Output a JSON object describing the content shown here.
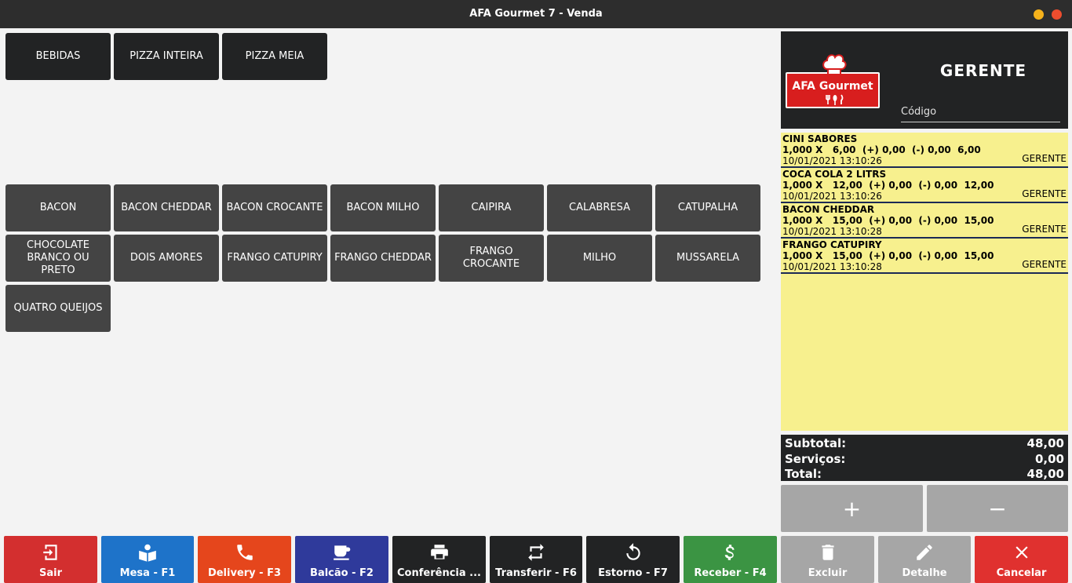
{
  "window": {
    "title": "AFA Gourmet 7 - Venda"
  },
  "categories": [
    "BEBIDAS",
    "PIZZA INTEIRA",
    "PIZZA MEIA"
  ],
  "products": [
    "BACON",
    "BACON CHEDDAR",
    "BACON CROCANTE",
    "BACON MILHO",
    "CAIPIRA",
    "CALABRESA",
    "CATUPALHA",
    "CHOCOLATE BRANCO OU PRETO",
    "DOIS AMORES",
    "FRANGO CATUPIRY",
    "FRANGO CHEDDAR",
    "FRANGO CROCANTE",
    "MILHO",
    "MUSSARELA",
    "QUATRO QUEIJOS"
  ],
  "header": {
    "logo_text": "AFA Gourmet",
    "user": "GERENTE",
    "code_placeholder": "Código"
  },
  "order_items": [
    {
      "name": "CINI SABORES",
      "line": "1,000 X   6,00  (+) 0,00  (-) 0,00  6,00",
      "datetime": "10/01/2021 13:10:26",
      "user": "GERENTE"
    },
    {
      "name": "COCA COLA 2 LITRS",
      "line": "1,000 X   12,00  (+) 0,00  (-) 0,00  12,00",
      "datetime": "10/01/2021 13:10:26",
      "user": "GERENTE"
    },
    {
      "name": "BACON CHEDDAR",
      "line": "1,000 X   15,00  (+) 0,00  (-) 0,00  15,00",
      "datetime": "10/01/2021 13:10:28",
      "user": "GERENTE"
    },
    {
      "name": "FRANGO CATUPIRY",
      "line": "1,000 X   15,00  (+) 0,00  (-) 0,00  15,00",
      "datetime": "10/01/2021 13:10:28",
      "user": "GERENTE"
    }
  ],
  "totals": {
    "subtotal_label": "Subtotal:",
    "subtotal": "48,00",
    "services_label": "Serviços:",
    "services": "0,00",
    "total_label": "Total:",
    "total": "48,00"
  },
  "qty_buttons": {
    "plus": "+",
    "minus": "−"
  },
  "actions": [
    {
      "label": "Sair",
      "icon": "exit-icon",
      "color": "#d32f2f"
    },
    {
      "label": "Mesa - F1",
      "icon": "table-icon",
      "color": "#1e73c9"
    },
    {
      "label": "Delivery - F3",
      "icon": "phone-icon",
      "color": "#e5461c"
    },
    {
      "label": "Balcão - F2",
      "icon": "coffee-icon",
      "color": "#2f3a9b"
    },
    {
      "label": "Conferência ...",
      "icon": "printer-icon",
      "color": "#222324"
    },
    {
      "label": "Transferir - F6",
      "icon": "transfer-icon",
      "color": "#222324"
    },
    {
      "label": "Estorno - F7",
      "icon": "undo-icon",
      "color": "#222324"
    },
    {
      "label": "Receber - F4",
      "icon": "dollar-icon",
      "color": "#3b9443"
    },
    {
      "label": "Excluir",
      "icon": "trash-icon",
      "color": "#a6a6a6"
    },
    {
      "label": "Detalhe",
      "icon": "pencil-icon",
      "color": "#a6a6a6"
    },
    {
      "label": "Cancelar",
      "icon": "close-icon",
      "color": "#e0312f"
    }
  ]
}
